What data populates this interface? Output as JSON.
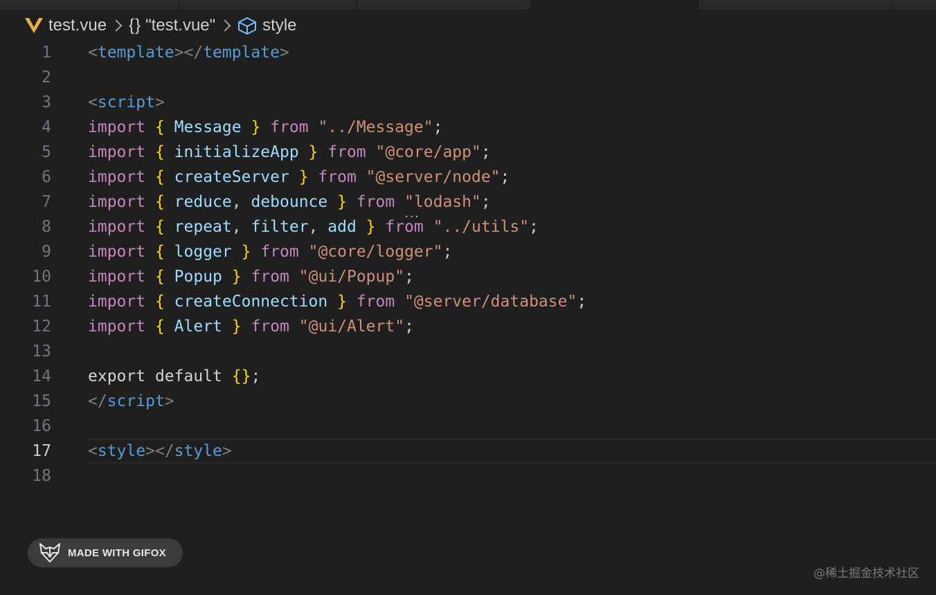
{
  "breadcrumb": {
    "file": "test.vue",
    "scope": "\"test.vue\"",
    "symbol": "style",
    "scope_icon": "{}"
  },
  "editor": {
    "current_line": 17,
    "lines": [
      {
        "n": "1",
        "tokens": [
          [
            "punc",
            "<"
          ],
          [
            "tag",
            "template"
          ],
          [
            "punc",
            "></"
          ],
          [
            "tag",
            "template"
          ],
          [
            "punc",
            ">"
          ]
        ]
      },
      {
        "n": "2",
        "tokens": []
      },
      {
        "n": "3",
        "tokens": [
          [
            "punc",
            "<"
          ],
          [
            "tag",
            "script"
          ],
          [
            "punc",
            ">"
          ]
        ]
      },
      {
        "n": "4",
        "tokens": [
          [
            "kw",
            "import"
          ],
          [
            "plain",
            " "
          ],
          [
            "brace",
            "{"
          ],
          [
            "plain",
            " "
          ],
          [
            "id",
            "Message"
          ],
          [
            "plain",
            " "
          ],
          [
            "brace",
            "}"
          ],
          [
            "plain",
            " "
          ],
          [
            "kw",
            "from"
          ],
          [
            "plain",
            " "
          ],
          [
            "str",
            "\"../Message\""
          ],
          [
            "plain",
            ";"
          ]
        ]
      },
      {
        "n": "5",
        "tokens": [
          [
            "kw",
            "import"
          ],
          [
            "plain",
            " "
          ],
          [
            "brace",
            "{"
          ],
          [
            "plain",
            " "
          ],
          [
            "id",
            "initializeApp"
          ],
          [
            "plain",
            " "
          ],
          [
            "brace",
            "}"
          ],
          [
            "plain",
            " "
          ],
          [
            "kw",
            "from"
          ],
          [
            "plain",
            " "
          ],
          [
            "str",
            "\"@core/app\""
          ],
          [
            "plain",
            ";"
          ]
        ]
      },
      {
        "n": "6",
        "tokens": [
          [
            "kw",
            "import"
          ],
          [
            "plain",
            " "
          ],
          [
            "brace",
            "{"
          ],
          [
            "plain",
            " "
          ],
          [
            "id",
            "createServer"
          ],
          [
            "plain",
            " "
          ],
          [
            "brace",
            "}"
          ],
          [
            "plain",
            " "
          ],
          [
            "kw",
            "from"
          ],
          [
            "plain",
            " "
          ],
          [
            "str",
            "\"@server/node\""
          ],
          [
            "plain",
            ";"
          ]
        ]
      },
      {
        "n": "7",
        "tokens": [
          [
            "kw",
            "import"
          ],
          [
            "plain",
            " "
          ],
          [
            "brace",
            "{"
          ],
          [
            "plain",
            " "
          ],
          [
            "id",
            "reduce"
          ],
          [
            "plain",
            ", "
          ],
          [
            "id",
            "debounce"
          ],
          [
            "plain",
            " "
          ],
          [
            "brace",
            "}"
          ],
          [
            "plain",
            " "
          ],
          [
            "kw",
            "from"
          ],
          [
            "plain",
            " "
          ],
          [
            "strdot",
            "\""
          ],
          [
            "str",
            "lodash\""
          ],
          [
            "plain",
            ";"
          ]
        ]
      },
      {
        "n": "8",
        "tokens": [
          [
            "kw",
            "import"
          ],
          [
            "plain",
            " "
          ],
          [
            "brace",
            "{"
          ],
          [
            "plain",
            " "
          ],
          [
            "id",
            "repeat"
          ],
          [
            "plain",
            ", "
          ],
          [
            "id",
            "filter"
          ],
          [
            "plain",
            ", "
          ],
          [
            "id",
            "add"
          ],
          [
            "plain",
            " "
          ],
          [
            "brace",
            "}"
          ],
          [
            "plain",
            " "
          ],
          [
            "kw",
            "from"
          ],
          [
            "plain",
            " "
          ],
          [
            "str",
            "\"../utils\""
          ],
          [
            "plain",
            ";"
          ]
        ]
      },
      {
        "n": "9",
        "tokens": [
          [
            "kw",
            "import"
          ],
          [
            "plain",
            " "
          ],
          [
            "brace",
            "{"
          ],
          [
            "plain",
            " "
          ],
          [
            "id",
            "logger"
          ],
          [
            "plain",
            " "
          ],
          [
            "brace",
            "}"
          ],
          [
            "plain",
            " "
          ],
          [
            "kw",
            "from"
          ],
          [
            "plain",
            " "
          ],
          [
            "str",
            "\"@core/logger\""
          ],
          [
            "plain",
            ";"
          ]
        ]
      },
      {
        "n": "10",
        "tokens": [
          [
            "kw",
            "import"
          ],
          [
            "plain",
            " "
          ],
          [
            "brace",
            "{"
          ],
          [
            "plain",
            " "
          ],
          [
            "id",
            "Popup"
          ],
          [
            "plain",
            " "
          ],
          [
            "brace",
            "}"
          ],
          [
            "plain",
            " "
          ],
          [
            "kw",
            "from"
          ],
          [
            "plain",
            " "
          ],
          [
            "str",
            "\"@ui/Popup\""
          ],
          [
            "plain",
            ";"
          ]
        ]
      },
      {
        "n": "11",
        "tokens": [
          [
            "kw",
            "import"
          ],
          [
            "plain",
            " "
          ],
          [
            "brace",
            "{"
          ],
          [
            "plain",
            " "
          ],
          [
            "id",
            "createConnection"
          ],
          [
            "plain",
            " "
          ],
          [
            "brace",
            "}"
          ],
          [
            "plain",
            " "
          ],
          [
            "kw",
            "from"
          ],
          [
            "plain",
            " "
          ],
          [
            "str",
            "\"@server/database\""
          ],
          [
            "plain",
            ";"
          ]
        ]
      },
      {
        "n": "12",
        "tokens": [
          [
            "kw",
            "import"
          ],
          [
            "plain",
            " "
          ],
          [
            "brace",
            "{"
          ],
          [
            "plain",
            " "
          ],
          [
            "id",
            "Alert"
          ],
          [
            "plain",
            " "
          ],
          [
            "brace",
            "}"
          ],
          [
            "plain",
            " "
          ],
          [
            "kw",
            "from"
          ],
          [
            "plain",
            " "
          ],
          [
            "str",
            "\"@ui/Alert\""
          ],
          [
            "plain",
            ";"
          ]
        ]
      },
      {
        "n": "13",
        "tokens": []
      },
      {
        "n": "14",
        "tokens": [
          [
            "kw2",
            "export"
          ],
          [
            "plain",
            " "
          ],
          [
            "kw2",
            "default"
          ],
          [
            "plain",
            " "
          ],
          [
            "brace",
            "{}"
          ],
          [
            "plain",
            ";"
          ]
        ]
      },
      {
        "n": "15",
        "tokens": [
          [
            "punc",
            "</"
          ],
          [
            "tag",
            "script"
          ],
          [
            "punc",
            ">"
          ]
        ]
      },
      {
        "n": "16",
        "tokens": []
      },
      {
        "n": "17",
        "tokens": [
          [
            "punc",
            "<"
          ],
          [
            "tag",
            "style"
          ],
          [
            "punc",
            "></"
          ],
          [
            "tag",
            "style"
          ],
          [
            "punc",
            ">"
          ]
        ]
      },
      {
        "n": "18",
        "tokens": []
      }
    ]
  },
  "badge": {
    "label": "MADE WITH GIFOX",
    "icon": "gifox-fox-icon"
  },
  "watermark": "@稀土掘金技术社区",
  "colors": {
    "background": "#1f1f1f",
    "keyword": "#c586c0",
    "tag": "#569cd6",
    "identifier": "#9cdcfe",
    "string": "#ce9178",
    "brace": "#ffd700",
    "vue_logo": "#e2b340"
  }
}
